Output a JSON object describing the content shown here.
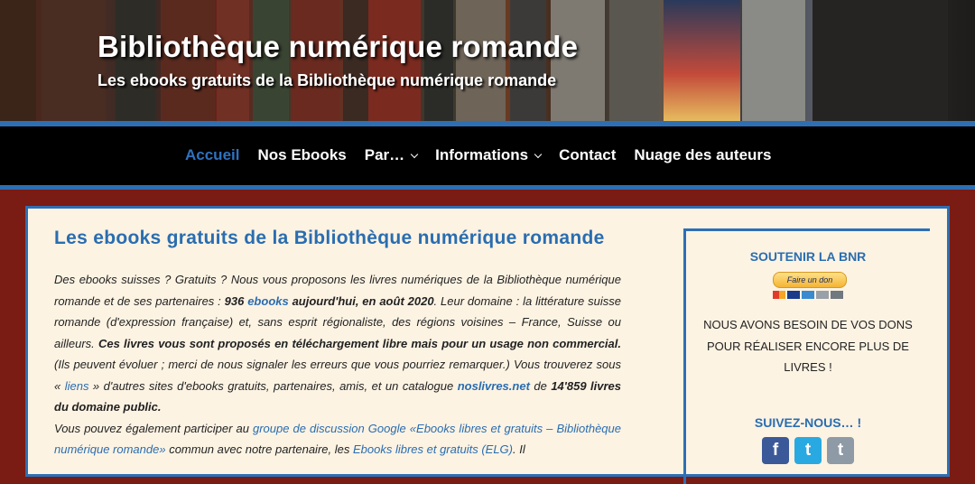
{
  "header": {
    "title": "Bibliothèque numérique romande",
    "subtitle": "Les ebooks gratuits de la Bibliothèque numérique romande"
  },
  "nav": {
    "items": [
      {
        "label": "Accueil",
        "active": true
      },
      {
        "label": "Nos Ebooks"
      },
      {
        "label": "Par…",
        "dropdown": true
      },
      {
        "label": "Informations",
        "dropdown": true
      },
      {
        "label": "Contact"
      },
      {
        "label": "Nuage des auteurs"
      }
    ]
  },
  "article": {
    "title": "Les ebooks gratuits de la Bibliothèque numérique romande",
    "p1_a": "Des ebooks suisses ? Gratuits ? Nous vous proposons les livres numériques de la Bibliothèque numérique romande et de ses partenaires : ",
    "count": "936",
    "ebooks_link": "ebooks",
    "date": "aujourd'hui, en août 2020",
    "p1_b": ". Leur domaine : la littérature suisse romande (d'expression française) et, sans esprit régionaliste, des régions voisines – France, Suisse ou ailleurs. ",
    "bold_free": "Ces livres vous sont proposés en téléchargement libre mais pour un usage non commercial.",
    "p1_c": " (Ils peuvent évoluer ; merci de nous signaler les erreurs que vous pourriez remarquer.) Vous trouverez sous « ",
    "liens_link": "liens",
    "p1_d": " » d'autres sites d'ebooks gratuits, partenaires, amis, et un catalogue ",
    "noslivres_link": "noslivres.net",
    "p1_e": " de ",
    "bold_count": "14'859 livres du domaine public.",
    "p2_a": "Vous pouvez également participer au ",
    "group_link": "groupe de discussion Google «Ebooks libres et gratuits – Bibliothèque numérique romande»",
    "p2_b": " commun avec notre partenaire, les ",
    "elg_link": "Ebooks libres et gratuits (ELG)",
    "p2_c": ". Il"
  },
  "sidebar": {
    "support_title": "SOUTENIR LA BNR",
    "donate_label": "Faire un don",
    "donate_text": "NOUS AVONS BESOIN DE VOS DONS POUR RÉALISER ENCORE PLUS DE LIVRES !",
    "follow_title": "SUIVEZ-NOUS… !",
    "social": [
      {
        "icon": "facebook-icon",
        "glyph": "f",
        "color": "#3b5998"
      },
      {
        "icon": "twitter-icon",
        "glyph": "t",
        "color": "#29a9e1"
      },
      {
        "icon": "tumblr-icon",
        "glyph": "t",
        "color": "#8e9aa6"
      }
    ]
  },
  "colors": {
    "accent": "#2e6fb4",
    "link": "#2a6db0",
    "background": "#7a1b14",
    "panel": "#fdf3e3"
  }
}
